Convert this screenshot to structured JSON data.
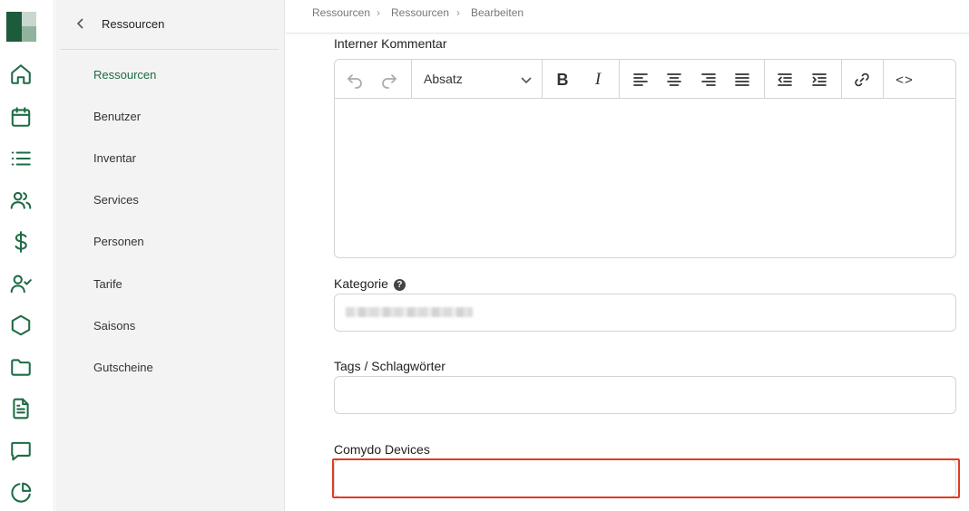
{
  "rail": {
    "icons": [
      "home-icon",
      "calendar-icon",
      "list-icon",
      "users-icon",
      "dollar-icon",
      "user-check-icon",
      "hexagon-icon",
      "folder-icon",
      "document-icon",
      "chat-icon",
      "pie-chart-icon"
    ],
    "accent": "#1e6b45"
  },
  "subnav": {
    "title": "Ressourcen",
    "items": [
      {
        "label": "Ressourcen",
        "active": true
      },
      {
        "label": "Benutzer"
      },
      {
        "label": "Inventar"
      },
      {
        "label": "Services"
      },
      {
        "label": "Personen"
      },
      {
        "label": "Tarife"
      },
      {
        "label": "Saisons"
      },
      {
        "label": "Gutscheine"
      }
    ]
  },
  "breadcrumb": [
    "Ressourcen",
    "Ressourcen",
    "Bearbeiten"
  ],
  "form": {
    "comment_label": "Interner Kommentar",
    "editor": {
      "block_format": "Absatz",
      "bold_glyph": "B",
      "italic_glyph": "I",
      "code_glyph": "<>"
    },
    "category_label": "Kategorie",
    "category_help": "?",
    "tags_label": "Tags / Schlagwörter",
    "devices_label": "Comydo Devices"
  },
  "colors": {
    "accent": "#1e6b45",
    "highlight": "#e23b22"
  }
}
